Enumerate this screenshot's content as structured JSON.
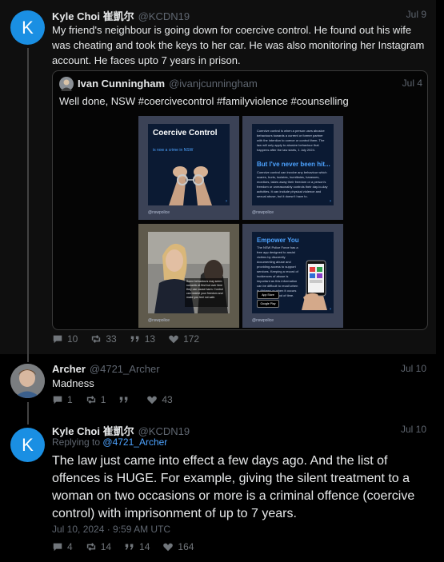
{
  "post1": {
    "author": "Kyle Choi 崔凱尔",
    "handle": "@KCDN19",
    "date": "Jul 9",
    "avatar_letter": "K",
    "text": "My friend's neighbour is going down for coercive control. He found out his wife was cheating and took the keys to her car. He was also monitoring her Instagram account. He faces upto 7 years in prison.",
    "stats": {
      "replies": "10",
      "reposts": "33",
      "quotes": "13",
      "likes": "172"
    }
  },
  "quote": {
    "author": "Ivan Cunningham",
    "handle": "@ivanjcunningham",
    "date": "Jul 4",
    "text": "Well done, NSW #coercivecontrol #familyviolence #counselling",
    "tiles": {
      "t1_title": "Coercive Control",
      "t1_sub": "is now a crime in NSW",
      "t2_body": "Coercive control is when a person uses abusive behaviours towards a current or former partner with the intention to coerce or control them. The law will only apply to abusive behaviour that happens after the law starts, 1 July 2024.",
      "t2_head": "But I've never been hit...",
      "t2_body2": "Coercive control can involve any behaviour which scares, hurts, isolates, humiliates, harasses, monitors, takes away their freedom or a person's freedom or unreasonably controls their day-to-day activities. It can include physical violence and sexual abuse, but it doesn't have to.",
      "t3_caption": "Some behaviours may seem romantic at first but over time they can cause harm. Control can restrict your freedom and make you feel not safe.",
      "t4_head": "Empower You",
      "t4_body": "The NSW Police Force has a free app designed to assist victims by discreetly documenting abuse and providing access to support services. Keeping a record of incidences of abuse is important as this information can be difficult to recall when in distress or when it occurs over a long period of time.",
      "app_store": "App Store",
      "google_play": "Google Play",
      "footer": "@nswpolice"
    }
  },
  "post2": {
    "author": "Archer",
    "handle": "@4721_Archer",
    "date": "Jul 10",
    "text": "Madness",
    "stats": {
      "replies": "1",
      "reposts": "1",
      "quotes": "",
      "likes": "43"
    }
  },
  "post3": {
    "author": "Kyle Choi 崔凱尔",
    "handle": "@KCDN19",
    "date": "Jul 10",
    "avatar_letter": "K",
    "replying_prefix": "Replying to",
    "replying_to": "@4721_Archer",
    "text": "The law just came into effect a few days ago. And the list of offences is HUGE. For example, giving the silent treatment to a woman on two occasions or more is a criminal offence (coercive control) with imprisonment of up to 7 years.",
    "timestamp": "Jul 10, 2024 · 9:59 AM UTC",
    "stats": {
      "replies": "4",
      "reposts": "14",
      "quotes": "14",
      "likes": "164"
    }
  }
}
